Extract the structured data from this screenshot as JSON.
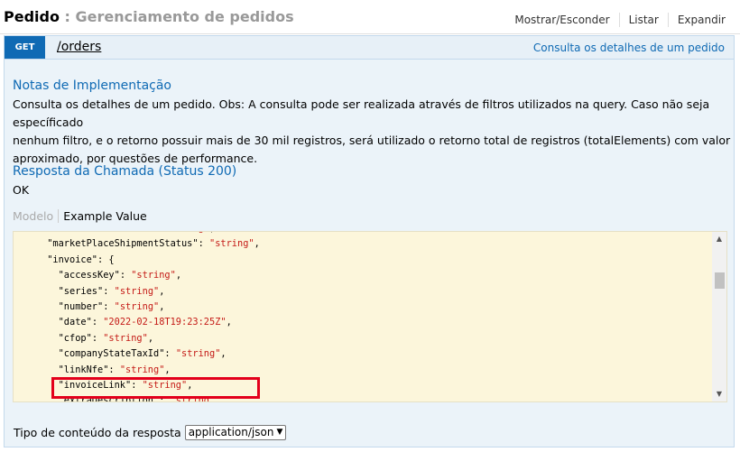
{
  "header": {
    "resource": "Pedido",
    "separator": " : ",
    "description": "Gerenciamento de pedidos",
    "actions": [
      "Mostrar/Esconder",
      "Listar",
      "Expandir"
    ]
  },
  "operation": {
    "method": "GET",
    "path": "/orders",
    "summary": "Consulta os detalhes de um pedido"
  },
  "implementation_notes": {
    "title": "Notas de Implementação",
    "lines": [
      "Consulta os detalhes de um pedido. Obs: A consulta pode ser realizada através de filtros utilizados na query. Caso não seja específicado",
      "nenhum filtro, e o retorno possuir mais de 30 mil registros, será utilizado o retorno total de registros (totalElements) com valor",
      "aproximado, por questões de performance."
    ]
  },
  "response": {
    "title": "Resposta da Chamada (Status 200)",
    "status_text": "OK"
  },
  "tabs": {
    "model": "Modelo",
    "example": "Example Value"
  },
  "code": [
    {
      "indent": "      ",
      "key": "\"marketPlaceStatus\"",
      "value": "\"string\"",
      "tail": ","
    },
    {
      "indent": "      ",
      "key": "\"marketPlaceShipmentStatus\"",
      "value": "\"string\"",
      "tail": ","
    },
    {
      "indent": "      ",
      "key": "\"invoice\"",
      "value": "",
      "tail": " {"
    },
    {
      "indent": "        ",
      "key": "\"accessKey\"",
      "value": "\"string\"",
      "tail": ","
    },
    {
      "indent": "        ",
      "key": "\"series\"",
      "value": "\"string\"",
      "tail": ","
    },
    {
      "indent": "        ",
      "key": "\"number\"",
      "value": "\"string\"",
      "tail": ","
    },
    {
      "indent": "        ",
      "key": "\"date\"",
      "value": "\"2022-02-18T19:23:25Z\"",
      "tail": ","
    },
    {
      "indent": "        ",
      "key": "\"cfop\"",
      "value": "\"string\"",
      "tail": ","
    },
    {
      "indent": "        ",
      "key": "\"companyStateTaxId\"",
      "value": "\"string\"",
      "tail": ","
    },
    {
      "indent": "        ",
      "key": "\"linkNfe\"",
      "value": "\"string\"",
      "tail": ","
    },
    {
      "indent": "        ",
      "key": "\"invoiceLink\"",
      "value": "\"string\"",
      "tail": ","
    },
    {
      "indent": "        ",
      "key": "\"extraDescription\"",
      "value": "\"string\"",
      "tail": ","
    }
  ],
  "content_type": {
    "label": "Tipo de conteúdo da resposta",
    "selected": "application/json"
  },
  "colors": {
    "get_method": "#0f6ab4",
    "panel_bg": "#ebf3f9",
    "code_bg": "#fcf6db",
    "string_value": "#c41a16",
    "highlight": "#e3001b"
  }
}
